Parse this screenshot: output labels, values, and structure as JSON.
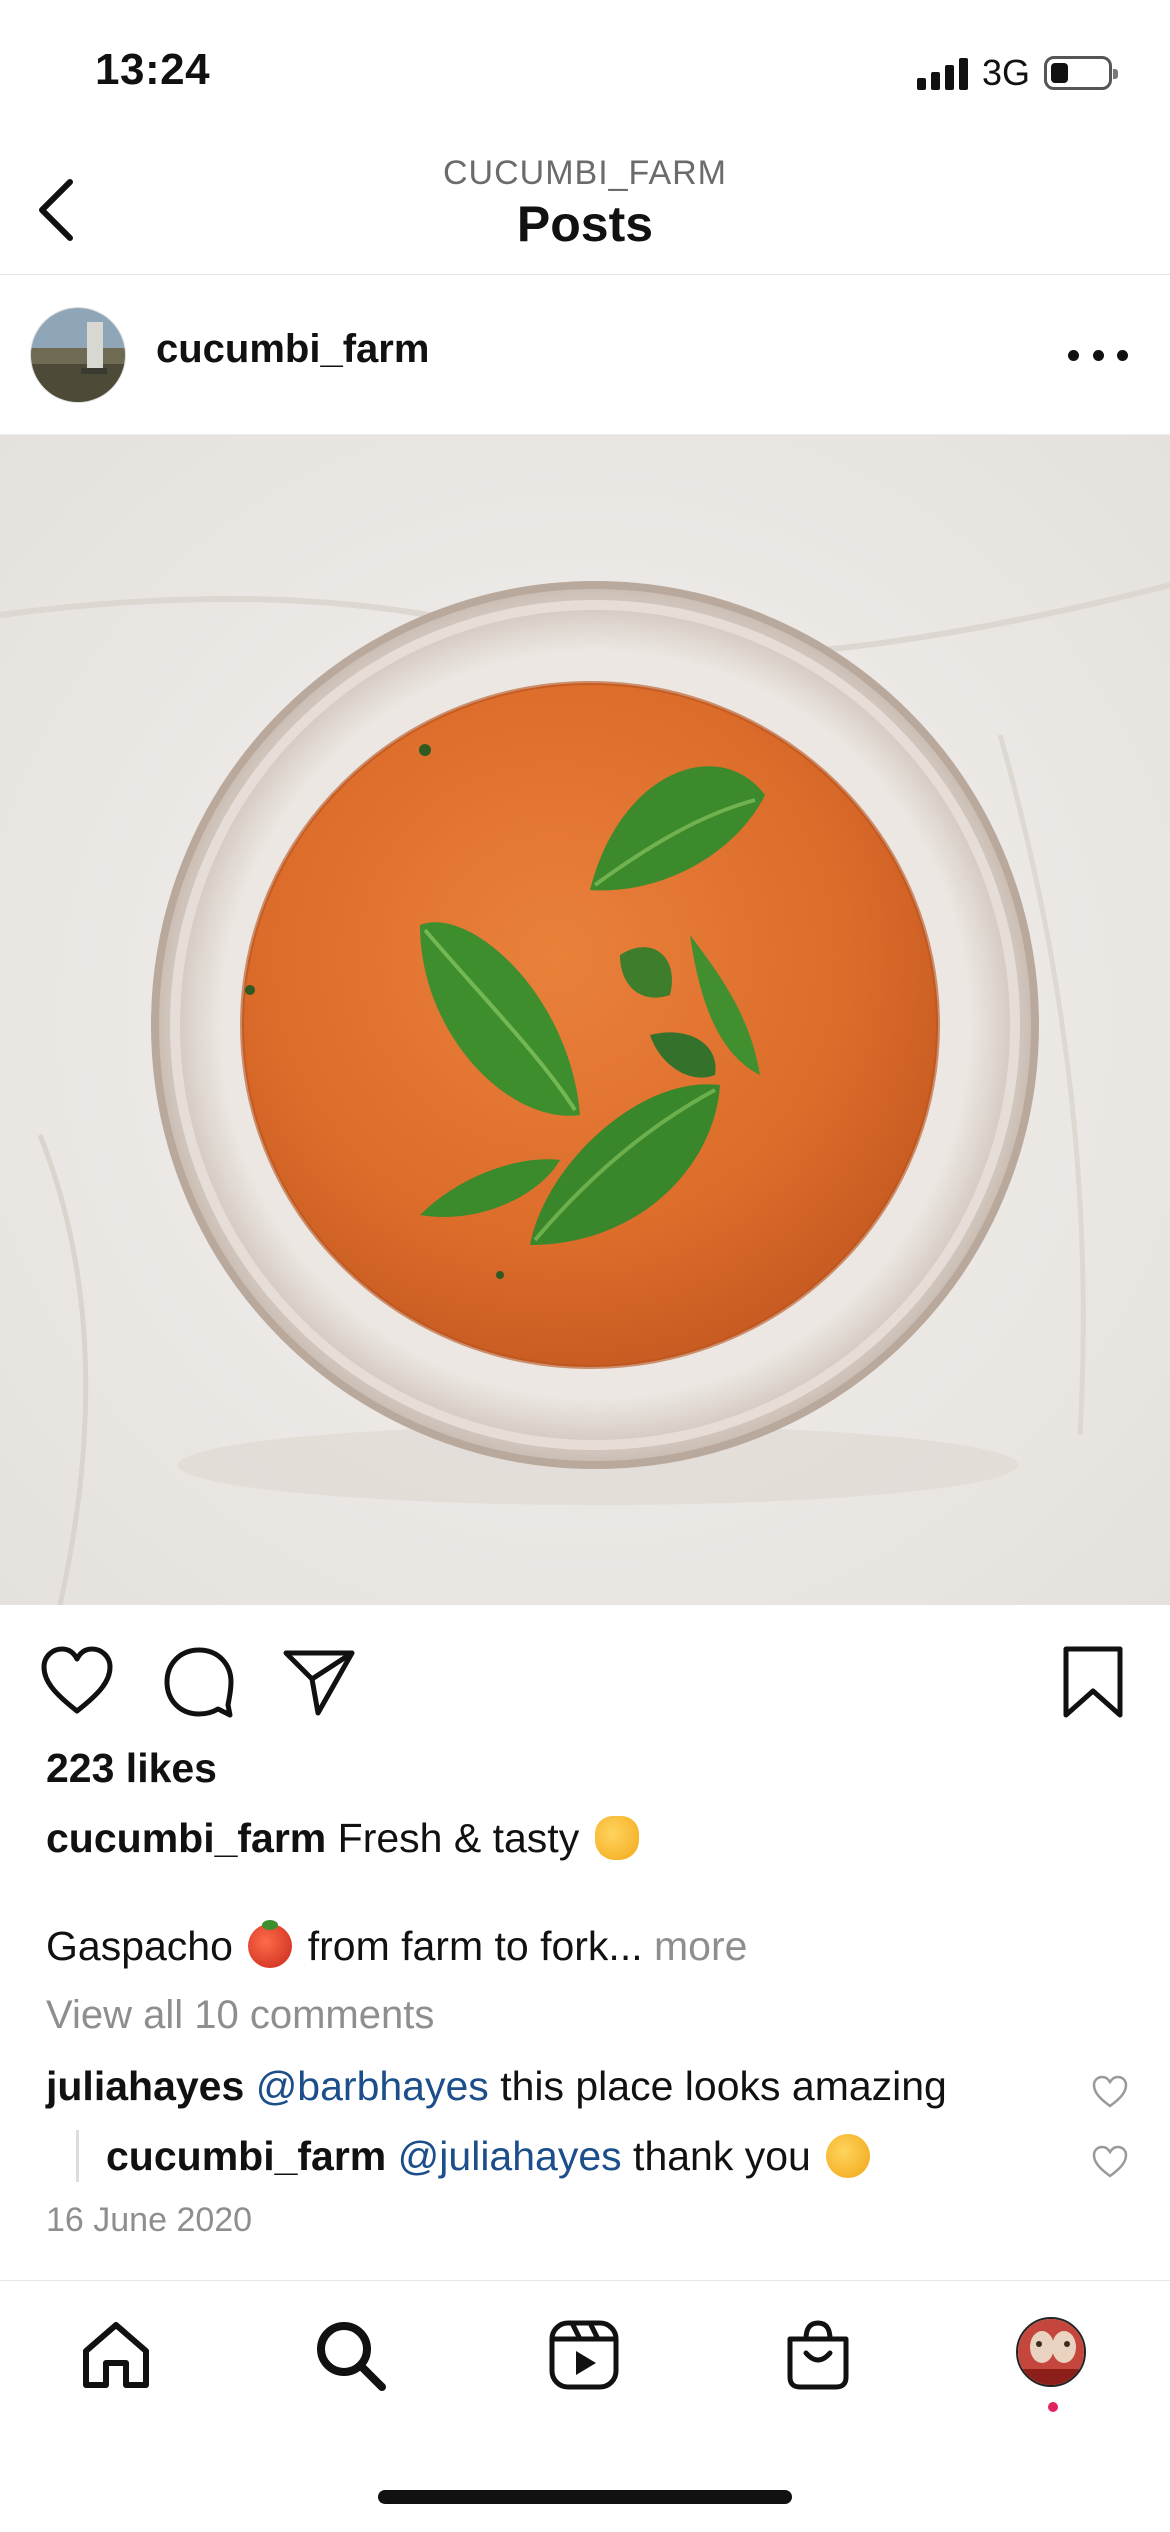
{
  "status_bar": {
    "time": "13:24",
    "network": "3G",
    "battery_level": 0.3
  },
  "header": {
    "account_upper": "CUCUMBI_FARM",
    "title": "Posts",
    "back_icon": "chevron-left-icon"
  },
  "post": {
    "username": "cucumbi_farm",
    "more_icon": "more-horizontal-icon",
    "image_alt": "Bowl of gaspacho with basil leaves",
    "likes": "223 likes",
    "caption_user": "cucumbi_farm",
    "caption_text": "Fresh & tasty",
    "caption_line2_a": "Gaspacho",
    "caption_line2_b": "from farm to fork...",
    "more_label": "more",
    "view_comments": "View all 10 comments",
    "comments": [
      {
        "user": "juliahayes",
        "mention": "@barbhayes",
        "text": "this place looks amazing"
      },
      {
        "user": "cucumbi_farm",
        "mention": "@juliahayes",
        "text": "thank you"
      }
    ],
    "date": "16 June 2020"
  },
  "actions": {
    "like_icon": "heart-icon",
    "comment_icon": "comment-icon",
    "share_icon": "send-icon",
    "save_icon": "bookmark-icon"
  },
  "tab_bar": {
    "items": [
      "home-icon",
      "search-icon",
      "reels-icon",
      "shop-icon",
      "profile-avatar"
    ]
  },
  "colors": {
    "mention": "#1b4e8a",
    "muted": "#8e8e8e",
    "notification_dot": "#e0245e"
  }
}
